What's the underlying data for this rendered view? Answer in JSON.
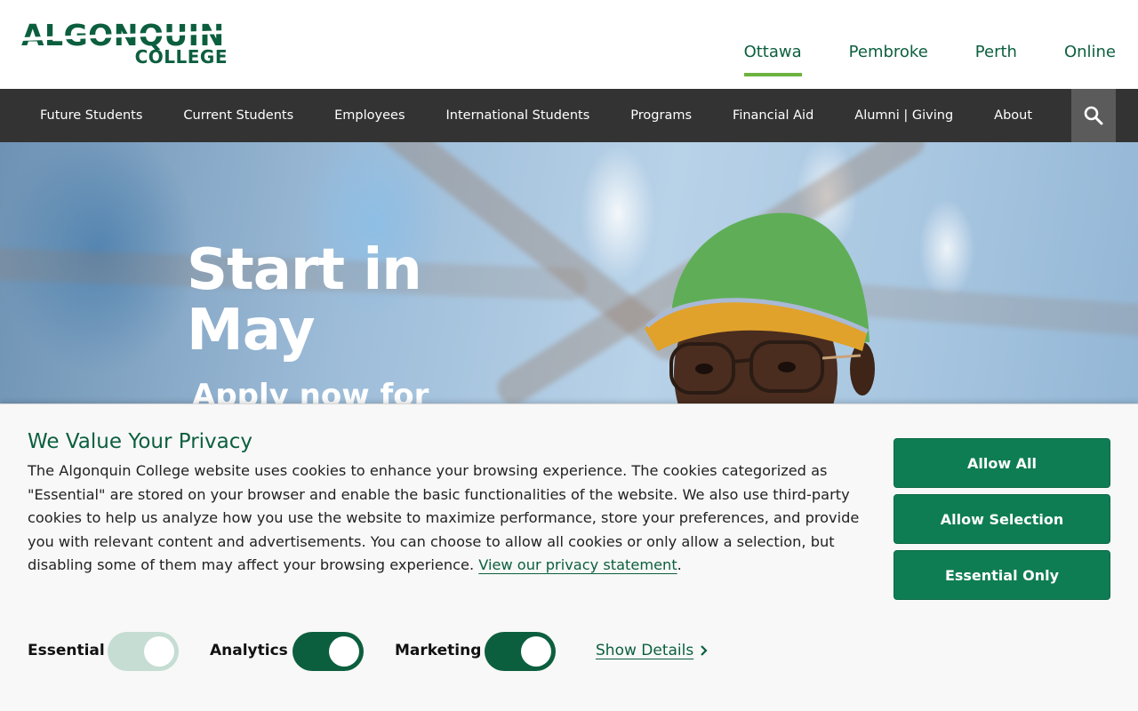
{
  "logo": {
    "line1": "ALGONQUIN",
    "line2": "COLLEGE"
  },
  "campus_nav": [
    "Ottawa",
    "Pembroke",
    "Perth",
    "Online"
  ],
  "active_campus": "Ottawa",
  "main_nav": [
    "Future Students",
    "Current Students",
    "Employees",
    "International Students",
    "Programs",
    "Financial Aid",
    "Alumni | Giving",
    "About"
  ],
  "search": {
    "icon": "search-icon"
  },
  "hero": {
    "title_line1": "Start in",
    "title_line2": "May",
    "subtitle": "Apply now for"
  },
  "cookie": {
    "title": "We Value Your Privacy",
    "body": "The Algonquin College website uses cookies to enhance your browsing experience. The cookies categorized as \"Essential\" are stored on your browser and enable the basic functionalities of the website. We also use third-party cookies to help us analyze how you use the website to maximize performance, store your preferences, and provide you with relevant content and advertisements. You can choose to allow all cookies or only allow a selection, but disabling some of them may affect your browsing experience.",
    "link": "View our privacy statement",
    "link_suffix": ".",
    "buttons": {
      "allow_all": "Allow All",
      "allow_selection": "Allow Selection",
      "essential_only": "Essential Only"
    },
    "toggles": {
      "essential": {
        "label": "Essential",
        "on": true,
        "disabled": true
      },
      "analytics": {
        "label": "Analytics",
        "on": true
      },
      "marketing": {
        "label": "Marketing",
        "on": true
      }
    },
    "show_details": "Show Details"
  },
  "colors": {
    "brand_green": "#0c5f3e",
    "button_green": "#0f7d53",
    "accent_green": "#6cb33f",
    "nav_bg": "#333333"
  }
}
